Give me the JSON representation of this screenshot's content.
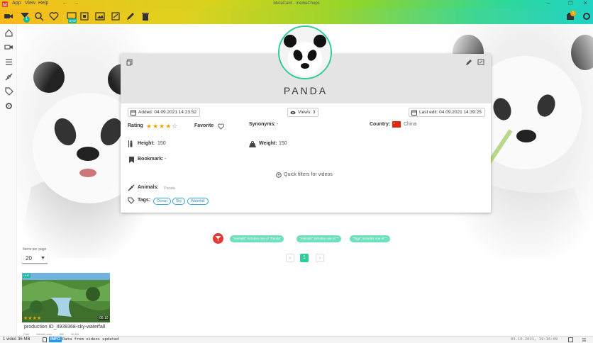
{
  "window": {
    "title": "MetaCard - mediaChops",
    "menu": [
      "App",
      "View",
      "Help"
    ]
  },
  "toolbar": {
    "filter_badge": "1",
    "video_badge": "UHD",
    "notif_badge": "1"
  },
  "card": {
    "title": "PANDA",
    "added": "Added: 04.09.2021 14:23:52",
    "views": "Views: 3",
    "last_edit": "Last edit: 04.09.2021 14:39:25",
    "rating_label": "Rating",
    "rating_value": 4,
    "rating_max": 5,
    "favorite_label": "Favorite",
    "synonyms_label": "Synonyms:",
    "synonyms_value": "-",
    "country_label": "Country:",
    "country_value": "China",
    "height_label": "Height:",
    "height_value": "150",
    "weight_label": "Weight:",
    "weight_value": "150",
    "bookmark_label": "Bookmark:",
    "bookmark_value": "-",
    "quick_filters": "Quick filters for videos",
    "animals_label": "Animals:",
    "animals_value": "Panda",
    "tags_label": "Tags:",
    "tags": [
      "Ocean",
      "Sky",
      "Waterfall"
    ]
  },
  "filters": [
    "\"Animals\" includes one of \"Panda\"",
    "\"Animals\" includes one of \"\"",
    "\"Tags\" includes one of \"\""
  ],
  "pagination": {
    "prev": "‹",
    "current": "1",
    "next": "›"
  },
  "items_per_page": {
    "label": "Items per page",
    "value": "20"
  },
  "video": {
    "badge": "UHD",
    "duration": "00:10",
    "title": "production ID_4939368-sky-waterfall",
    "rating": 4,
    "meta": [
      "Path",
      "MediaFolder",
      "850",
      "38 KB"
    ]
  },
  "statusbar": {
    "count": "1 video 36 MB",
    "info_badge": "INFO",
    "message": "Data from videos updated",
    "datetime": "03.10.2021, 19:16:09"
  },
  "colors": {
    "accent": "#2ecc9a",
    "star": "#f0a500",
    "tag": "#35a6d1",
    "filter_chip": "#6fe0bd",
    "red_filter": "#e53935"
  }
}
